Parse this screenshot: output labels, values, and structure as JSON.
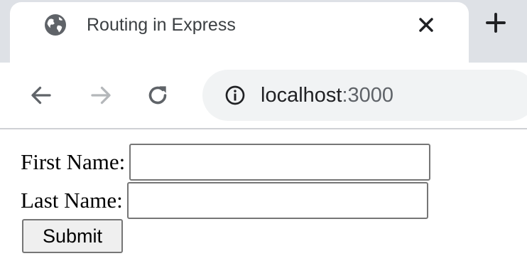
{
  "browser": {
    "tab": {
      "title": "Routing in Express",
      "favicon": "globe-icon",
      "close_icon": "close-icon"
    },
    "new_tab_icon": "plus-icon",
    "toolbar": {
      "back_icon": "back-arrow-icon",
      "forward_icon": "forward-arrow-icon",
      "reload_icon": "reload-icon",
      "info_icon": "info-icon",
      "url_host": "localhost",
      "url_port": ":3000"
    }
  },
  "form": {
    "first_name_label": "First Name:",
    "first_name_value": "",
    "last_name_label": "Last Name:",
    "last_name_value": "",
    "submit_label": "Submit"
  },
  "colors": {
    "tab_strip": "#dee1e6",
    "omnibox": "#f1f3f4",
    "cropped_text": "#1a5aa6"
  }
}
